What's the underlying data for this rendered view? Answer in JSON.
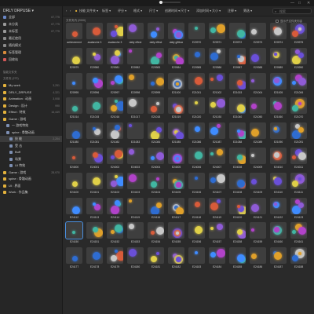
{
  "titlebar": {
    "minimize": "—",
    "maximize": "□",
    "close": "✕"
  },
  "sidebar": {
    "library": "DRLY DRPUSE ▾",
    "quick": [
      {
        "icon": "all-icon",
        "label": "全部",
        "count": "67,775",
        "color": "#6a87c6"
      },
      {
        "icon": "uncategorized-icon",
        "label": "未分类",
        "count": "67,775",
        "color": "#9a9a9a"
      },
      {
        "icon": "untagged-icon",
        "label": "未标签",
        "count": "67,775",
        "color": "#9a9a9a"
      },
      {
        "icon": "recent-icon",
        "label": "最近使用",
        "count": "",
        "color": "#8b8b8b"
      },
      {
        "icon": "random-icon",
        "label": "随机模式",
        "count": "",
        "color": "#8b8b8b"
      },
      {
        "icon": "tags-icon",
        "label": "标签管理",
        "count": "",
        "color": "#d98c3b"
      },
      {
        "icon": "trash-icon",
        "label": "回收站",
        "count": "",
        "color": "#d45858"
      }
    ],
    "smart_heading": "智能文件夹",
    "folders_heading": "文件夹 (272)",
    "folders": [
      {
        "label": "My work",
        "count": "3,251",
        "indent": 1,
        "color": "#e2b13c",
        "selected": false
      },
      {
        "label": "DRLY_DRPUSE",
        "count": "4,321",
        "indent": 1,
        "color": "#e2b13c",
        "selected": false
      },
      {
        "label": "Animation : 动画",
        "count": "3,008",
        "indent": 1,
        "color": "#e2b13c",
        "selected": false
      },
      {
        "label": "Design : 设计",
        "count": "990",
        "indent": 1,
        "color": "#e2b13c",
        "selected": false
      },
      {
        "label": "Effect : 特效",
        "count": "16,449",
        "indent": 1,
        "color": "#e2b13c",
        "selected": false
      },
      {
        "label": "Game : 游戏",
        "count": "",
        "indent": 1,
        "color": "#e2b13c",
        "selected": false
      },
      {
        "label": "一 游戏特效",
        "count": "",
        "indent": 2,
        "color": "#7d8fb3",
        "selected": false
      },
      {
        "label": "spine : 骨骼动画",
        "count": "",
        "indent": 2,
        "color": "#7d8fb3",
        "selected": false
      },
      {
        "label": "技 能",
        "count": "2,204",
        "indent": 3,
        "color": "#7d8fb3",
        "selected": true
      },
      {
        "label": "受 击",
        "count": "",
        "indent": 3,
        "color": "#7d8fb3",
        "selected": false
      },
      {
        "label": "Buff",
        "count": "",
        "indent": 3,
        "color": "#7d8fb3",
        "selected": false
      },
      {
        "label": "场景",
        "count": "",
        "indent": 3,
        "color": "#7d8fb3",
        "selected": false
      },
      {
        "label": "UI 特效",
        "count": "",
        "indent": 3,
        "color": "#7d8fb3",
        "selected": false
      },
      {
        "label": "Game : 游戏",
        "count": "28,970",
        "indent": 1,
        "color": "#e2b13c",
        "selected": false
      },
      {
        "label": "spine : 骨骼动画",
        "count": "",
        "indent": 1,
        "color": "#e2b13c",
        "selected": false
      },
      {
        "label": "UI : 界面",
        "count": "",
        "indent": 1,
        "color": "#e2b13c",
        "selected": false
      },
      {
        "label": "Work : 作品集",
        "count": "",
        "indent": 1,
        "color": "#e2b13c",
        "selected": false
      }
    ]
  },
  "toolbar": {
    "back": "‹",
    "forward": "›",
    "folder_name": "技能",
    "filters": [
      "文件夹 ▾",
      "标签 ▾",
      "评分 ▾",
      "格式 ▾",
      "尺寸 ▾",
      "创建时间 ▾",
      "尺寸 ▾",
      "添加时间 ▾",
      "大小 ▾",
      "注释 ▾",
      "筛选 ▾"
    ],
    "search_placeholder": "搜索",
    "search_icon": "search-icon"
  },
  "filterbar": {
    "group_label": "文件夹内 (2000)",
    "subfolder_option": "显示子文件夹内容"
  },
  "grid": {
    "items": [
      "achievement\nanimation",
      "avalanche 3",
      "avalanche 3",
      "daily effect",
      "daily effect",
      "daily giftbox",
      "E20970",
      "E20971",
      "E20972",
      "E20973",
      "E20974",
      "E20975",
      "E20979",
      "E20980",
      "E20981",
      "E20982",
      "E20983",
      "E20984",
      "E20985",
      "E20986",
      "E20987",
      "E20988",
      "E20989",
      "E20990",
      "E20995",
      "E20996",
      "E20997",
      "E20998",
      "E20999",
      "E21000",
      "E21001",
      "E21002",
      "E21003",
      "E21004",
      "E21005",
      "E21006",
      "E21014",
      "E21015",
      "E21016",
      "E21017",
      "E21018",
      "E21019",
      "E21020",
      "E21030",
      "E21040",
      "E21050",
      "E21060",
      "E21070",
      "E21080",
      "E21081",
      "E21082",
      "E21083",
      "E21084",
      "E21085",
      "E21086",
      "E21087",
      "E21088",
      "E21089",
      "E21090",
      "E21091",
      "E24000",
      "E24001",
      "E24002",
      "E24003",
      "E24004",
      "E24005",
      "E24006",
      "E24007",
      "E24008",
      "E24009",
      "E24010",
      "E24011",
      "E24100",
      "E24101",
      "E24102",
      "E24103",
      "E24104",
      "E24105",
      "E24106",
      "E24107",
      "E24108",
      "E24109",
      "E24110",
      "E24111",
      "E24112",
      "E24113",
      "E24114",
      "E24115",
      "E24116",
      "E24117",
      "E24118",
      "E24119",
      "E24120",
      "E24121",
      "E24122",
      "E24123",
      "E24150",
      "E24151",
      "E24152",
      "E24153",
      "E24154",
      "E24155",
      "E24156",
      "E24157",
      "E24158",
      "E24159",
      "E24160",
      "E24161",
      "E24177",
      "E24178",
      "E24179",
      "E24180",
      "E24181",
      "E24182",
      "E24183",
      "E24184",
      "E24185",
      "E24186",
      "E24187",
      "E24188"
    ],
    "palette": [
      "#6a4fd8",
      "#3f8cff",
      "#e0a02a",
      "#d85b3a",
      "#8f5bd6",
      "#41b6a2",
      "#c7c7c7",
      "#e0d048",
      "#b142c9",
      "#2e6cd1"
    ]
  }
}
